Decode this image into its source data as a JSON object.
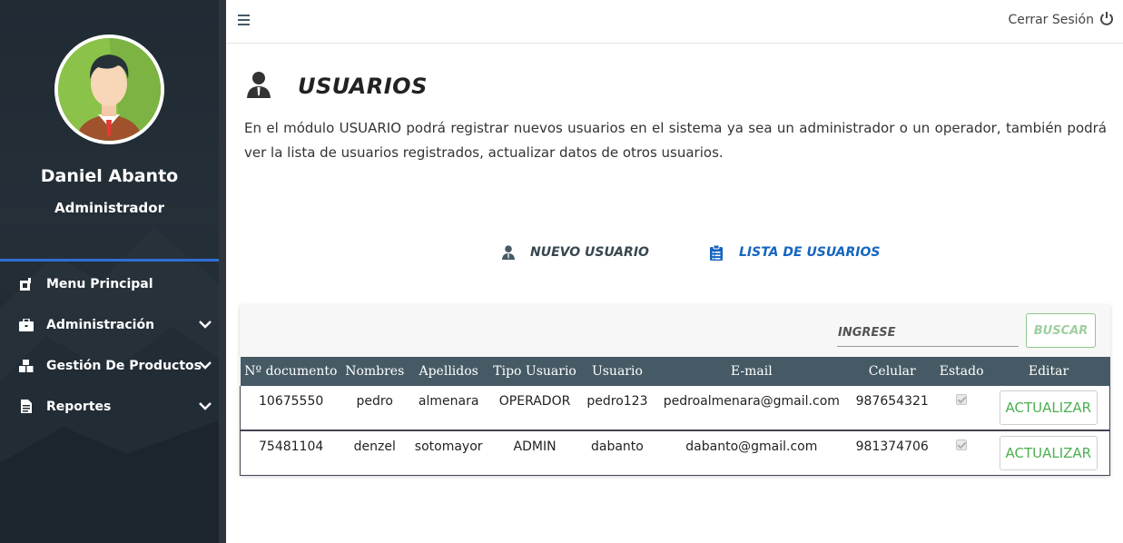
{
  "sidebar": {
    "user_name": "Daniel Abanto",
    "user_role": "Administrador",
    "items": [
      {
        "label": "Menu Principal",
        "icon": "dashboard-icon",
        "has_submenu": false
      },
      {
        "label": "Administración",
        "icon": "briefcase-icon",
        "has_submenu": true
      },
      {
        "label": "Gestión De Productos",
        "icon": "boxes-icon",
        "has_submenu": true
      },
      {
        "label": "Reportes",
        "icon": "file-icon",
        "has_submenu": true
      }
    ]
  },
  "topbar": {
    "logout_label": "Cerrar Sesión"
  },
  "page": {
    "title": "USUARIOS",
    "description": "En el módulo USUARIO podrá registrar nuevos usuarios en el sistema ya sea un administrador o un operador, también podrá ver la lista de usuarios registrados, actualizar datos de otros usuarios."
  },
  "tabs": [
    {
      "label": "NUEVO USUARIO",
      "icon": "user-tie-icon",
      "active": false
    },
    {
      "label": "LISTA DE USUARIOS",
      "icon": "clipboard-list-icon",
      "active": true
    }
  ],
  "search": {
    "placeholder": "INGRESE",
    "button_label": "BUSCAR"
  },
  "table": {
    "columns": [
      "Nº documento",
      "Nombres",
      "Apellidos",
      "Tipo Usuario",
      "Usuario",
      "E-mail",
      "Celular",
      "Estado",
      "Editar"
    ],
    "rows": [
      {
        "documento": "10675550",
        "nombres": "pedro",
        "apellidos": "almenara",
        "tipo": "OPERADOR",
        "usuario": "pedro123",
        "email": "pedroalmenara@gmail.com",
        "celular": "987654321",
        "estado": true,
        "action": "ACTUALIZAR"
      },
      {
        "documento": "75481104",
        "nombres": "denzel",
        "apellidos": "sotomayor",
        "tipo": "ADMIN",
        "usuario": "dabanto",
        "email": "dabanto@gmail.com",
        "celular": "981374706",
        "estado": true,
        "action": "ACTUALIZAR"
      }
    ]
  },
  "colors": {
    "accent_blue": "#1565c0",
    "sidebar_bg": "#1f2a33",
    "table_header": "#455a64",
    "success_green": "#4caf50"
  }
}
